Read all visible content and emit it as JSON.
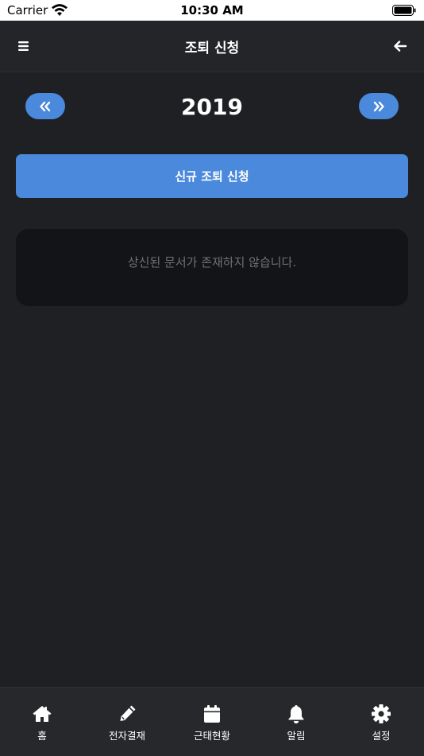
{
  "status_bar": {
    "carrier": "Carrier",
    "time": "10:30 AM"
  },
  "nav": {
    "title": "조퇴 신청",
    "menu_icon": "menu-icon",
    "back_icon": "arrow-left-icon"
  },
  "year_selector": {
    "year": "2019",
    "prev_icon": "double-chevron-left-icon",
    "next_icon": "double-chevron-right-icon"
  },
  "new_request": {
    "label": "신규 조퇴 신청"
  },
  "empty_state": {
    "message": "상신된 문서가 존재하지 않습니다."
  },
  "colors": {
    "accent": "#4a89dc",
    "background": "#1f2024",
    "card": "#131417"
  },
  "tabs": [
    {
      "label": "홈",
      "icon": "home-icon"
    },
    {
      "label": "전자결재",
      "icon": "pencil-icon"
    },
    {
      "label": "근태현황",
      "icon": "calendar-icon"
    },
    {
      "label": "알림",
      "icon": "bell-icon"
    },
    {
      "label": "설정",
      "icon": "gear-icon"
    }
  ]
}
